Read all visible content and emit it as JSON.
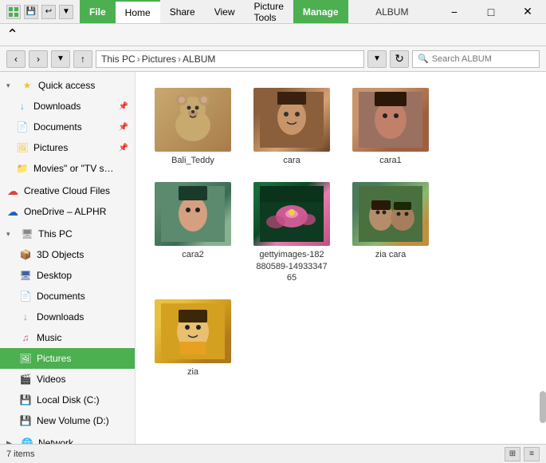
{
  "titleBar": {
    "appTitle": "ALBUM",
    "tabs": [
      {
        "id": "file",
        "label": "File"
      },
      {
        "id": "home",
        "label": "Home"
      },
      {
        "id": "share",
        "label": "Share"
      },
      {
        "id": "view",
        "label": "View"
      },
      {
        "id": "picture-tools",
        "label": "Picture Tools"
      },
      {
        "id": "manage",
        "label": "Manage"
      }
    ],
    "winControls": [
      "−",
      "□",
      "✕"
    ]
  },
  "addressBar": {
    "backBtn": "‹",
    "forwardBtn": "›",
    "upBtn": "↑",
    "pathParts": [
      "This PC",
      "Pictures",
      "ALBUM"
    ],
    "refreshBtn": "↻",
    "searchPlaceholder": "Search ALBUM"
  },
  "sidebar": {
    "quickAccess": [
      {
        "id": "downloads-quick",
        "label": "Downloads",
        "icon": "↓",
        "iconClass": "icon-downloads",
        "pinned": true
      },
      {
        "id": "documents-quick",
        "label": "Documents",
        "icon": "📄",
        "iconClass": "icon-documents",
        "pinned": true
      },
      {
        "id": "pictures-quick",
        "label": "Pictures",
        "icon": "🖼",
        "iconClass": "icon-pictures",
        "pinned": true
      },
      {
        "id": "movies-quick",
        "label": "Movies\" or \"TV s…",
        "icon": "📁",
        "iconClass": "icon-movies"
      }
    ],
    "cloudItems": [
      {
        "id": "creative-cloud",
        "label": "Creative Cloud Files",
        "icon": "☁",
        "iconClass": "icon-cloud"
      },
      {
        "id": "onedrive",
        "label": "OneDrive – ALPHR",
        "icon": "☁",
        "iconClass": "icon-onedrive"
      }
    ],
    "thisPC": {
      "label": "This PC",
      "icon": "💻",
      "iconClass": "icon-pc",
      "children": [
        {
          "id": "3d-objects",
          "label": "3D Objects",
          "icon": "📦",
          "iconClass": "icon-3d"
        },
        {
          "id": "desktop",
          "label": "Desktop",
          "icon": "🖥",
          "iconClass": "icon-desktop"
        },
        {
          "id": "documents-pc",
          "label": "Documents",
          "icon": "📄",
          "iconClass": "icon-documents"
        },
        {
          "id": "downloads-pc",
          "label": "Downloads",
          "icon": "↓",
          "iconClass": "icon-downloads"
        },
        {
          "id": "music",
          "label": "Music",
          "icon": "♪",
          "iconClass": "icon-music"
        },
        {
          "id": "pictures-pc",
          "label": "Pictures",
          "icon": "🖼",
          "iconClass": "icon-pictures",
          "active": true
        },
        {
          "id": "videos",
          "label": "Videos",
          "icon": "🎬",
          "iconClass": "icon-videos"
        },
        {
          "id": "local-disk",
          "label": "Local Disk (C:)",
          "icon": "💾",
          "iconClass": "icon-disk"
        },
        {
          "id": "new-volume",
          "label": "New Volume (D:)",
          "icon": "💾",
          "iconClass": "icon-disk"
        }
      ]
    },
    "network": {
      "id": "network",
      "label": "Network",
      "icon": "🌐",
      "iconClass": "icon-network"
    }
  },
  "files": [
    {
      "id": "bali-teddy",
      "name": "Bali_Teddy",
      "thumbClass": "thumb-teddy"
    },
    {
      "id": "cara",
      "name": "cara",
      "thumbClass": "thumb-cara"
    },
    {
      "id": "cara1",
      "name": "cara1",
      "thumbClass": "thumb-cara1"
    },
    {
      "id": "cara2",
      "name": "cara2",
      "thumbClass": "thumb-cara2"
    },
    {
      "id": "gettyimages",
      "name": "gettyimages-182\n880589-14933347\n65",
      "thumbClass": "thumb-lotus"
    },
    {
      "id": "zia-cara",
      "name": "zia cara",
      "thumbClass": "thumb-zia-cara"
    },
    {
      "id": "zia",
      "name": "zia",
      "thumbClass": "thumb-zia"
    }
  ],
  "statusBar": {
    "itemCount": "7 items",
    "viewBtns": [
      "⊞",
      "≡"
    ]
  }
}
